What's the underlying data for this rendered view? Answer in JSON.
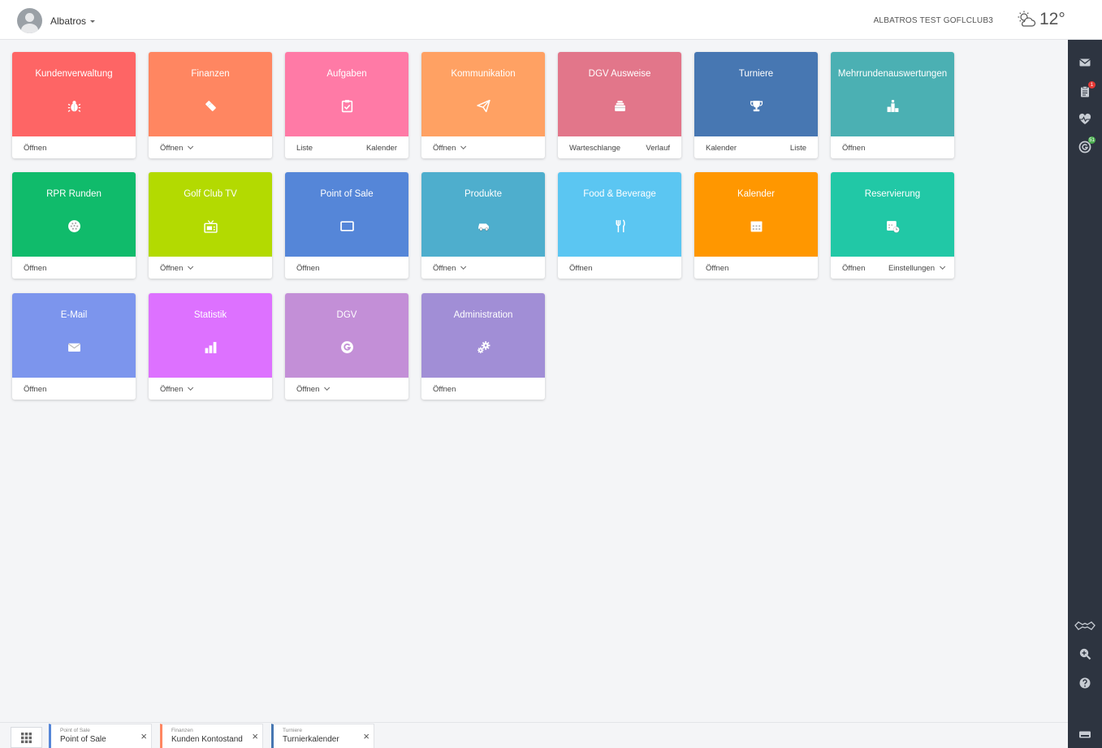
{
  "header": {
    "user_name": "Albatros",
    "club_name": "ALBATROS TEST GOFLCLUB3",
    "temperature": "12°"
  },
  "sidebar": {
    "icons": [
      "mail-icon",
      "clipboard-icon",
      "heartbeat-icon",
      "dgv-icon",
      "glasses-icon",
      "zoom-in-icon",
      "help-icon"
    ],
    "badges": {
      "clipboard": "1",
      "dgv": "51"
    },
    "badge_colors": {
      "clipboard": "#e53935",
      "dgv": "#4caf50"
    }
  },
  "tiles": [
    {
      "title": "Kundenverwaltung",
      "icon": "bug-icon",
      "color": "#fe6565",
      "left": "Öffnen",
      "left_chevron": false,
      "right": "",
      "right_chevron": false
    },
    {
      "title": "Finanzen",
      "icon": "ticket-icon",
      "color": "#ff8661",
      "left": "Öffnen",
      "left_chevron": true,
      "right": "",
      "right_chevron": false
    },
    {
      "title": "Aufgaben",
      "icon": "checklist-icon",
      "color": "#ff7aa6",
      "left": "Liste",
      "left_chevron": false,
      "right": "Kalender",
      "right_chevron": false
    },
    {
      "title": "Kommunikation",
      "icon": "paper-plane-icon",
      "color": "#ffa163",
      "left": "Öffnen",
      "left_chevron": true,
      "right": "",
      "right_chevron": false
    },
    {
      "title": "DGV Ausweise",
      "icon": "card-stack-icon",
      "color": "#e2768a",
      "left": "Warteschlange",
      "left_chevron": false,
      "right": "Verlauf",
      "right_chevron": false
    },
    {
      "title": "Turniere",
      "icon": "trophy-icon",
      "color": "#4777b2",
      "left": "Kalender",
      "left_chevron": false,
      "right": "Liste",
      "right_chevron": false
    },
    {
      "title": "Mehrrundenauswertungen",
      "icon": "podium-icon",
      "color": "#4bb0b3",
      "left": "Öffnen",
      "left_chevron": false,
      "right": "",
      "right_chevron": false
    },
    {
      "title": "RPR Runden",
      "icon": "golf-ball-icon",
      "color": "#10bb6b",
      "left": "Öffnen",
      "left_chevron": false,
      "right": "",
      "right_chevron": false
    },
    {
      "title": "Golf Club TV",
      "icon": "tv-icon",
      "color": "#b3da01",
      "left": "Öffnen",
      "left_chevron": true,
      "right": "",
      "right_chevron": false
    },
    {
      "title": "Point of Sale",
      "icon": "tablet-icon",
      "color": "#5586d8",
      "left": "Öffnen",
      "left_chevron": false,
      "right": "",
      "right_chevron": false
    },
    {
      "title": "Produkte",
      "icon": "golf-cart-icon",
      "color": "#4eaecd",
      "left": "Öffnen",
      "left_chevron": true,
      "right": "",
      "right_chevron": false
    },
    {
      "title": "Food & Beverage",
      "icon": "cutlery-icon",
      "color": "#5bc6f2",
      "left": "Öffnen",
      "left_chevron": false,
      "right": "",
      "right_chevron": false
    },
    {
      "title": "Kalender",
      "icon": "calendar-icon",
      "color": "#ff9700",
      "left": "Öffnen",
      "left_chevron": false,
      "right": "",
      "right_chevron": false
    },
    {
      "title": "Reservierung",
      "icon": "calendar-clock-icon",
      "color": "#21c8a6",
      "left": "Öffnen",
      "left_chevron": false,
      "right": "Einstellungen",
      "right_chevron": true
    },
    {
      "title": "E-Mail",
      "icon": "envelope-icon",
      "color": "#7c95ed",
      "left": "Öffnen",
      "left_chevron": false,
      "right": "",
      "right_chevron": false
    },
    {
      "title": "Statistik",
      "icon": "bar-chart-icon",
      "color": "#dd71ff",
      "left": "Öffnen",
      "left_chevron": true,
      "right": "",
      "right_chevron": false
    },
    {
      "title": "DGV",
      "icon": "dgv-logo-icon",
      "color": "#c38fd7",
      "left": "Öffnen",
      "left_chevron": true,
      "right": "",
      "right_chevron": false
    },
    {
      "title": "Administration",
      "icon": "gears-icon",
      "color": "#a18ed6",
      "left": "Öffnen",
      "left_chevron": false,
      "right": "",
      "right_chevron": false
    }
  ],
  "bottom_tabs": [
    {
      "category": "Point of Sale",
      "label": "Point of Sale",
      "color": "#5586d8"
    },
    {
      "category": "Finanzen",
      "label": "Kunden Kontostand",
      "color": "#ff8661"
    },
    {
      "category": "Turniere",
      "label": "Turnierkalender",
      "color": "#4777b2"
    }
  ]
}
